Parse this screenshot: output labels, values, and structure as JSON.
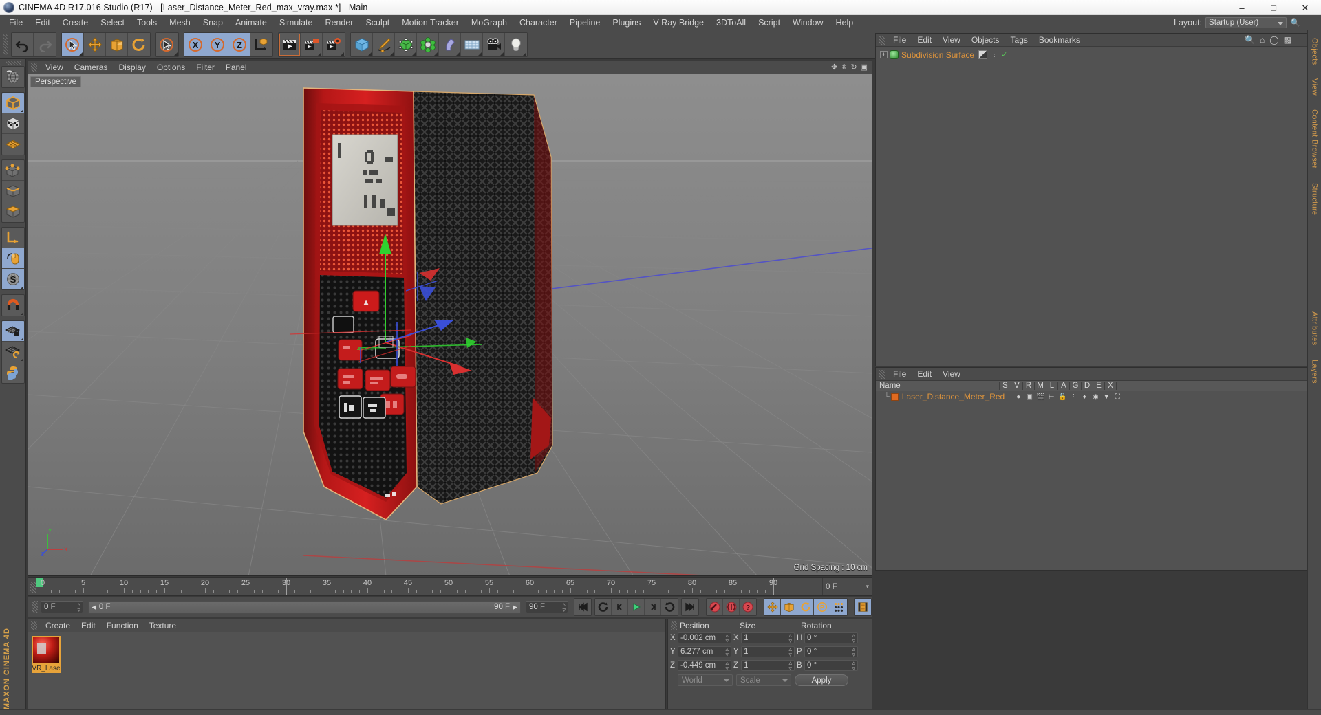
{
  "window": {
    "title": "CINEMA 4D R17.016 Studio (R17) - [Laser_Distance_Meter_Red_max_vray.max *] - Main",
    "app_icon": "c4d-logo-icon",
    "minimize": "–",
    "maximize": "□",
    "close": "✕"
  },
  "menubar": {
    "items": [
      "File",
      "Edit",
      "Create",
      "Select",
      "Tools",
      "Mesh",
      "Snap",
      "Animate",
      "Simulate",
      "Render",
      "Sculpt",
      "Motion Tracker",
      "MoGraph",
      "Character",
      "Pipeline",
      "Plugins",
      "V-Ray Bridge",
      "3DToAll",
      "Script",
      "Window",
      "Help"
    ],
    "layout_label": "Layout:",
    "layout_value": "Startup (User)",
    "search_icon": "search-icon"
  },
  "toolbar": {
    "groups": [
      {
        "name": "undo-redo",
        "buttons": [
          {
            "name": "undo-button",
            "icon": "undo-arrow-icon",
            "active": false,
            "corner": false
          },
          {
            "name": "redo-button",
            "icon": "redo-arrow-icon",
            "active": false,
            "corner": false
          }
        ]
      },
      {
        "name": "selection-tools",
        "buttons": [
          {
            "name": "live-selection-button",
            "icon": "cursor-circle-icon",
            "active": true,
            "corner": true
          },
          {
            "name": "move-button",
            "icon": "move-cross-icon",
            "active": false,
            "corner": false
          },
          {
            "name": "scale-button",
            "icon": "scale-box-icon",
            "active": false,
            "corner": false
          },
          {
            "name": "rotate-button",
            "icon": "rotate-circle-icon",
            "active": false,
            "corner": false
          }
        ]
      },
      {
        "name": "last-used-tool",
        "buttons": [
          {
            "name": "last-selection-button",
            "icon": "cursor-circle-icon",
            "active": false,
            "corner": true
          }
        ]
      },
      {
        "name": "axis-locks",
        "buttons": [
          {
            "name": "lock-x-button",
            "icon": "axis-x-icon",
            "active": true,
            "corner": false
          },
          {
            "name": "lock-y-button",
            "icon": "axis-y-icon",
            "active": true,
            "corner": false
          },
          {
            "name": "lock-z-button",
            "icon": "axis-z-icon",
            "active": true,
            "corner": false
          },
          {
            "name": "world-object-coords-button",
            "icon": "world-axis-icon",
            "active": false,
            "corner": false
          }
        ]
      },
      {
        "name": "render-tools",
        "buttons": [
          {
            "name": "render-view-button",
            "icon": "clapperboard-icon",
            "active": false,
            "corner": false,
            "framed": true
          },
          {
            "name": "render-region-button",
            "icon": "clapperboard-region-icon",
            "active": false,
            "corner": true
          },
          {
            "name": "render-settings-button",
            "icon": "clapperboard-gear-icon",
            "active": false,
            "corner": true
          }
        ]
      },
      {
        "name": "create-objects",
        "buttons": [
          {
            "name": "add-cube-button",
            "icon": "cube-icon",
            "active": false,
            "corner": true
          },
          {
            "name": "add-spline-button",
            "icon": "pen-spline-icon",
            "active": false,
            "corner": true
          },
          {
            "name": "add-generator-button",
            "icon": "generator-nurbs-icon",
            "active": false,
            "corner": true
          },
          {
            "name": "add-mograph-button",
            "icon": "mograph-cluster-icon",
            "active": false,
            "corner": true
          },
          {
            "name": "add-deformer-button",
            "icon": "bend-deformer-icon",
            "active": false,
            "corner": true
          },
          {
            "name": "add-environment-button",
            "icon": "floor-grid-icon",
            "active": false,
            "corner": true
          },
          {
            "name": "add-camera-button",
            "icon": "camera-icon",
            "active": false,
            "corner": true
          },
          {
            "name": "add-light-button",
            "icon": "light-bulb-icon",
            "active": false,
            "corner": true
          }
        ]
      }
    ]
  },
  "left_toolbar": {
    "groups": [
      {
        "name": "undo-view-group",
        "buttons": [
          {
            "name": "make-editable-globe-button",
            "icon": "globe-wire-icon",
            "active": false
          }
        ]
      },
      {
        "name": "mode-group-a",
        "buttons": [
          {
            "name": "model-mode-button",
            "icon": "model-cube-icon",
            "active": true
          },
          {
            "name": "texture-mode-button",
            "icon": "texture-cube-icon",
            "active": false
          },
          {
            "name": "workplane-mode-button",
            "icon": "workplane-grid-icon",
            "active": false
          }
        ]
      },
      {
        "name": "component-group",
        "buttons": [
          {
            "name": "points-mode-button",
            "icon": "points-cube-icon",
            "active": false
          },
          {
            "name": "edges-mode-button",
            "icon": "edges-cube-icon",
            "active": false
          },
          {
            "name": "polygons-mode-button",
            "icon": "polygons-cube-icon",
            "active": false
          }
        ]
      },
      {
        "name": "axis-group",
        "buttons": [
          {
            "name": "enable-axis-button",
            "icon": "axis-l-icon",
            "active": false
          },
          {
            "name": "viewport-solo-button",
            "icon": "mouse-icon",
            "active": true
          },
          {
            "name": "snap-settings-button",
            "icon": "s-circle-icon",
            "active": true
          }
        ]
      },
      {
        "name": "magnet-group",
        "buttons": [
          {
            "name": "magnet-button",
            "icon": "magnet-icon",
            "active": false
          }
        ]
      },
      {
        "name": "workplane-group",
        "buttons": [
          {
            "name": "lock-workplane-button",
            "icon": "workplane-lock-icon",
            "active": true
          },
          {
            "name": "planar-workplane-button",
            "icon": "workplane-rotate-icon",
            "active": false
          },
          {
            "name": "python-button",
            "icon": "python-icon",
            "active": false
          }
        ]
      }
    ],
    "brand": "MAXON CINEMA 4D"
  },
  "viewport": {
    "menu_items": [
      "View",
      "Cameras",
      "Display",
      "Options",
      "Filter",
      "Panel"
    ],
    "tab_label": "Perspective",
    "grid_spacing": "Grid Spacing : 10 cm",
    "axis_gizmo_labels": {
      "x": "X",
      "y": "Y",
      "z": "Z"
    },
    "nav_icons": [
      "pan-icon",
      "zoom-icon",
      "rotate-icon",
      "maximize-view-icon"
    ]
  },
  "object_manager": {
    "menu_items": [
      "File",
      "Edit",
      "View",
      "Objects",
      "Tags",
      "Bookmarks"
    ],
    "header_icons": [
      "search-icon",
      "home-icon",
      "ellipse-icon",
      "fit-icon"
    ],
    "objects": [
      {
        "name": "Subdivision Surface",
        "expand": "+",
        "icon": "subdivision-surface-icon",
        "tags": [
          "material-tag-icon",
          "visibility-dots-icon",
          "enabled-check-icon"
        ]
      }
    ]
  },
  "lower_manager": {
    "menu_items": [
      "File",
      "Edit",
      "View"
    ],
    "columns": [
      "Name",
      "S",
      "V",
      "R",
      "M",
      "L",
      "A",
      "G",
      "D",
      "E",
      "X"
    ],
    "rows": [
      {
        "name": "Laser_Distance_Meter_Red",
        "swatch_color": "#e06a20",
        "icons": [
          "dot-icon",
          "camera-view-icon",
          "render-icon",
          "hierarchy-icon",
          "unlock-icon",
          "layer-icon",
          "deform-icon",
          "phong-icon",
          "display-icon",
          "xref-icon"
        ]
      }
    ]
  },
  "dock_tabs": [
    "Objects",
    "View",
    "Content Browser",
    "Structure",
    "Attributes",
    "Layers"
  ],
  "timeline": {
    "ticks": [
      0,
      5,
      10,
      15,
      20,
      25,
      30,
      35,
      40,
      45,
      50,
      55,
      60,
      65,
      70,
      75,
      80,
      85,
      90
    ],
    "current_frame_marker": 0,
    "end_field": "0 F"
  },
  "transport": {
    "current_frame": "0 F",
    "range_start": "0 F",
    "range_end": "90 F",
    "max_frame": "90 F",
    "buttons": [
      {
        "name": "go-to-start-button",
        "icon": "skip-start-icon",
        "active": false
      },
      {
        "name": "play-reverse-loop-button",
        "icon": "loop-reverse-icon",
        "active": false
      },
      {
        "name": "previous-frame-button",
        "icon": "step-back-icon",
        "active": false
      },
      {
        "name": "play-button",
        "icon": "play-icon",
        "active": false
      },
      {
        "name": "next-frame-button",
        "icon": "step-forward-icon",
        "active": false
      },
      {
        "name": "play-forward-loop-button",
        "icon": "loop-forward-icon",
        "active": false
      },
      {
        "name": "go-to-end-button",
        "icon": "skip-end-icon",
        "active": false
      },
      {
        "name": "record-active-objects-button",
        "icon": "record-key-icon",
        "active": false
      },
      {
        "name": "autokeying-button",
        "icon": "autokey-icon",
        "active": false
      },
      {
        "name": "keyframe-selection-button",
        "icon": "key-question-icon",
        "active": false
      },
      {
        "name": "record-position-button",
        "icon": "move-cross-icon",
        "active": true
      },
      {
        "name": "record-scale-button",
        "icon": "scale-box-icon",
        "active": true
      },
      {
        "name": "record-rotation-button",
        "icon": "rotate-circle-icon",
        "active": true
      },
      {
        "name": "record-param-button",
        "icon": "p-circle-icon",
        "active": true
      },
      {
        "name": "record-pla-button",
        "icon": "point-level-icon",
        "active": true
      },
      {
        "name": "timeline-toggle-button",
        "icon": "timeline-strip-icon",
        "active": true
      }
    ]
  },
  "material_manager": {
    "menu_items": [
      "Create",
      "Edit",
      "Function",
      "Texture"
    ],
    "materials": [
      {
        "name": "VR_Lase",
        "preview": "red-laser-meter-material"
      }
    ]
  },
  "coordinates": {
    "headers": [
      "Position",
      "Size",
      "Rotation"
    ],
    "position": {
      "x_label": "X",
      "x": "-0.002 cm",
      "y_label": "Y",
      "y": "6.277 cm",
      "z_label": "Z",
      "z": "-0.449 cm"
    },
    "size": {
      "x_label": "X",
      "x": "1",
      "y_label": "Y",
      "y": "1",
      "z_label": "Z",
      "z": "1"
    },
    "rotation": {
      "h_label": "H",
      "h": "0 °",
      "p_label": "P",
      "p": "0 °",
      "b_label": "B",
      "b": "0 °"
    },
    "space_dropdown": "World",
    "mode_dropdown": "Scale",
    "apply_button": "Apply"
  },
  "colors": {
    "panel_bg": "#4b4b4b",
    "panel_body": "#525252",
    "accent_orange": "#e0953c",
    "accent_blue": "#8fa8cf",
    "axis_x": "#d33a3a",
    "axis_y": "#3fd43f",
    "axis_z": "#3a55d3",
    "material_orange": "#e7a33a",
    "dock_tab": "#d29a4c"
  }
}
